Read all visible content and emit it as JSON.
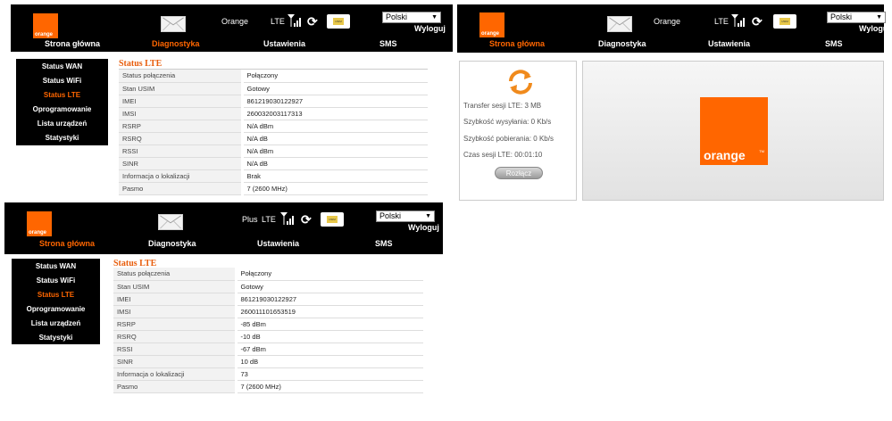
{
  "brand": {
    "logo_text": "orange",
    "trademark": "TM"
  },
  "common": {
    "lang": "Polski",
    "lang_arrow": "▼",
    "logout": "Wyloguj",
    "lte": "LTE",
    "usim_label": "USIM"
  },
  "nav": [
    "Strona główna",
    "Diagnostyka",
    "Ustawienia",
    "SMS"
  ],
  "sidebar": [
    "Status WAN",
    "Status WiFi",
    "Status LTE",
    "Oprogramowanie",
    "Lista urządzeń",
    "Statystyki"
  ],
  "colors": {
    "accent": "#ff6600",
    "header_bg": "#000000",
    "title": "#e85d0c"
  },
  "icons": {
    "signal": "signal-bars-icon",
    "refresh": "refresh-arrows-icon",
    "mail": "envelope-icon",
    "usim": "usim-card-icon"
  },
  "screen1": {
    "operator": "Orange",
    "section_title": "Status LTE",
    "rows": [
      {
        "label": "Status połączenia",
        "value": "Połączony"
      },
      {
        "label": "Stan USIM",
        "value": "Gotowy"
      },
      {
        "label": "IMEI",
        "value": "861219030122927"
      },
      {
        "label": "IMSI",
        "value": "260032003117313"
      },
      {
        "label": "RSRP",
        "value": "N/A dBm"
      },
      {
        "label": "RSRQ",
        "value": "N/A dB"
      },
      {
        "label": "RSSI",
        "value": "N/A dBm"
      },
      {
        "label": "SINR",
        "value": "N/A dB"
      },
      {
        "label": "Informacja o lokalizacji",
        "value": "Brak"
      },
      {
        "label": "Pasmo",
        "value": "7 (2600 MHz)"
      }
    ]
  },
  "screen2": {
    "operator": "Orange",
    "session": {
      "transfer": "Transfer sesji LTE: 3 MB",
      "upload": "Szybkość wysyłania: 0 Kb/s",
      "download": "Szybkość pobierania: 0 Kb/s",
      "time": "Czas sesji LTE: 00:01:10",
      "disconnect": "Rozłącz"
    }
  },
  "screen3": {
    "operator": "Plus",
    "section_title": "Status LTE",
    "rows": [
      {
        "label": "Status połączenia",
        "value": "Połączony"
      },
      {
        "label": "Stan USIM",
        "value": "Gotowy"
      },
      {
        "label": "IMEI",
        "value": "861219030122927"
      },
      {
        "label": "IMSI",
        "value": "260011101653519"
      },
      {
        "label": "RSRP",
        "value": "-85 dBm"
      },
      {
        "label": "RSRQ",
        "value": "-10 dB"
      },
      {
        "label": "RSSI",
        "value": "-67 dBm"
      },
      {
        "label": "SINR",
        "value": "10 dB"
      },
      {
        "label": "Informacja o lokalizacji",
        "value": "73"
      },
      {
        "label": "Pasmo",
        "value": "7 (2600 MHz)"
      }
    ]
  }
}
